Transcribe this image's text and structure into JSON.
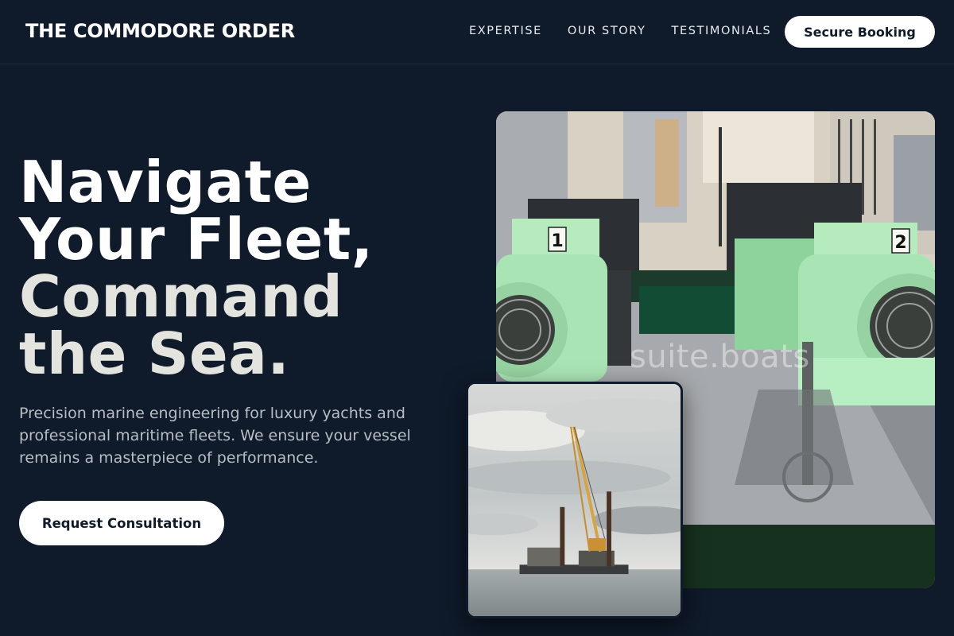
{
  "brand": {
    "name": "THE COMMODORE ORDER"
  },
  "nav": {
    "links": [
      "EXPERTISE",
      "OUR STORY",
      "TESTIMONIALS"
    ],
    "cta_label": "Secure Booking"
  },
  "hero": {
    "headline_line1": "Navigate",
    "headline_line2": "Your Fleet,",
    "headline_line3": "Command",
    "headline_line4": "the Sea.",
    "lede": "Precision marine engineering for luxury yachts and professional maritime fleets. We ensure your vessel remains a masterpiece of performance.",
    "cta_label": "Request Consultation"
  },
  "images": {
    "main_watermark": "suite.boats",
    "main_badge_1": "1",
    "main_badge_2": "2"
  },
  "colors": {
    "background": "#0f1a2a",
    "button_bg": "#ffffff",
    "button_text": "#0f1a2a",
    "motor_green": "#a9e4b4"
  }
}
